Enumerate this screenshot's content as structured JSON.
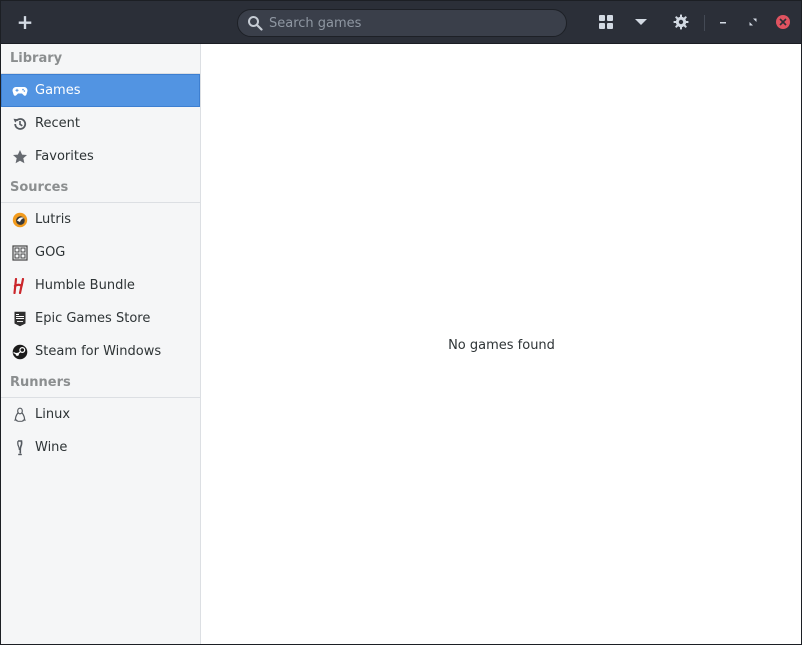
{
  "headerbar": {
    "add_icon": "plus-icon",
    "search": {
      "placeholder": "Search games",
      "value": ""
    },
    "view_icon": "grid-view-icon",
    "dropdown_icon": "pan-down-icon",
    "prefs_icon": "gear-icon",
    "window_controls": [
      "minimize-icon",
      "maximize-icon",
      "close-icon"
    ],
    "close_color": "#e05360"
  },
  "sidebar": {
    "sections": {
      "library": "Library",
      "sources": "Sources",
      "runners": "Runners"
    },
    "library_items": [
      {
        "label": "Games",
        "icon": "gamepad-icon",
        "selected": true
      },
      {
        "label": "Recent",
        "icon": "history-icon"
      },
      {
        "label": "Favorites",
        "icon": "star-icon"
      }
    ],
    "source_items": [
      {
        "label": "Lutris",
        "icon": "lutris-icon"
      },
      {
        "label": "GOG",
        "icon": "gog-icon"
      },
      {
        "label": "Humble Bundle",
        "icon": "humble-bundle-icon"
      },
      {
        "label": "Epic Games Store",
        "icon": "epic-games-icon"
      },
      {
        "label": "Steam for Windows",
        "icon": "steam-icon"
      }
    ],
    "runner_items": [
      {
        "label": "Linux",
        "icon": "linux-icon"
      },
      {
        "label": "Wine",
        "icon": "wine-icon"
      }
    ]
  },
  "main": {
    "empty_message": "No games found"
  },
  "colors": {
    "headerbar_bg": "#2b2f38",
    "accent": "#5294e2",
    "sidebar_bg": "#f5f6f7"
  }
}
